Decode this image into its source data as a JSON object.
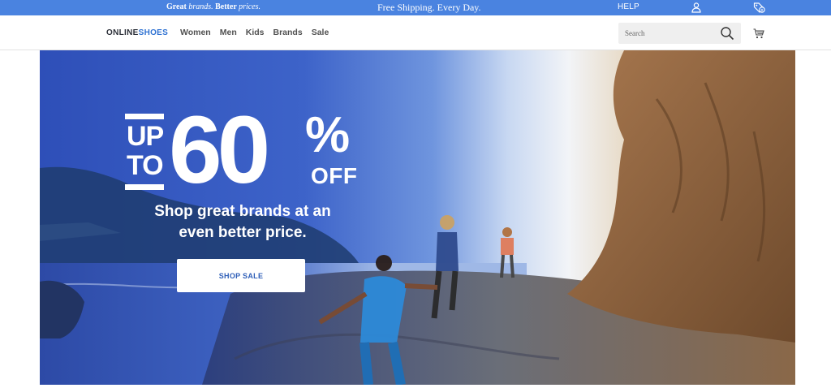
{
  "topbar": {
    "tagline_prefix": "Great ",
    "tagline_em1": "brands.",
    "tagline_mid": " Better ",
    "tagline_em2": "prices.",
    "shipping": "Free Shipping. Every Day.",
    "help": "HELP",
    "account_icon": "user-icon",
    "rewards_icon": "tag-icon",
    "background_color": "#4a83e0"
  },
  "header": {
    "logo_part1": "ONLINE",
    "logo_part2": "SHOES",
    "nav": [
      "Women",
      "Men",
      "Kids",
      "Brands",
      "Sale"
    ],
    "search_placeholder": "Search",
    "search_icon": "search-icon",
    "cart_icon": "cart-icon",
    "brand_color": "#2f72d2"
  },
  "hero": {
    "up": "UP",
    "to": "TO",
    "discount": "60",
    "percent": "%",
    "off": "OFF",
    "subheadline": "Shop great brands at an even better price.",
    "cta_label": "SHOP SALE",
    "cta_color": "#2f5fb8"
  }
}
